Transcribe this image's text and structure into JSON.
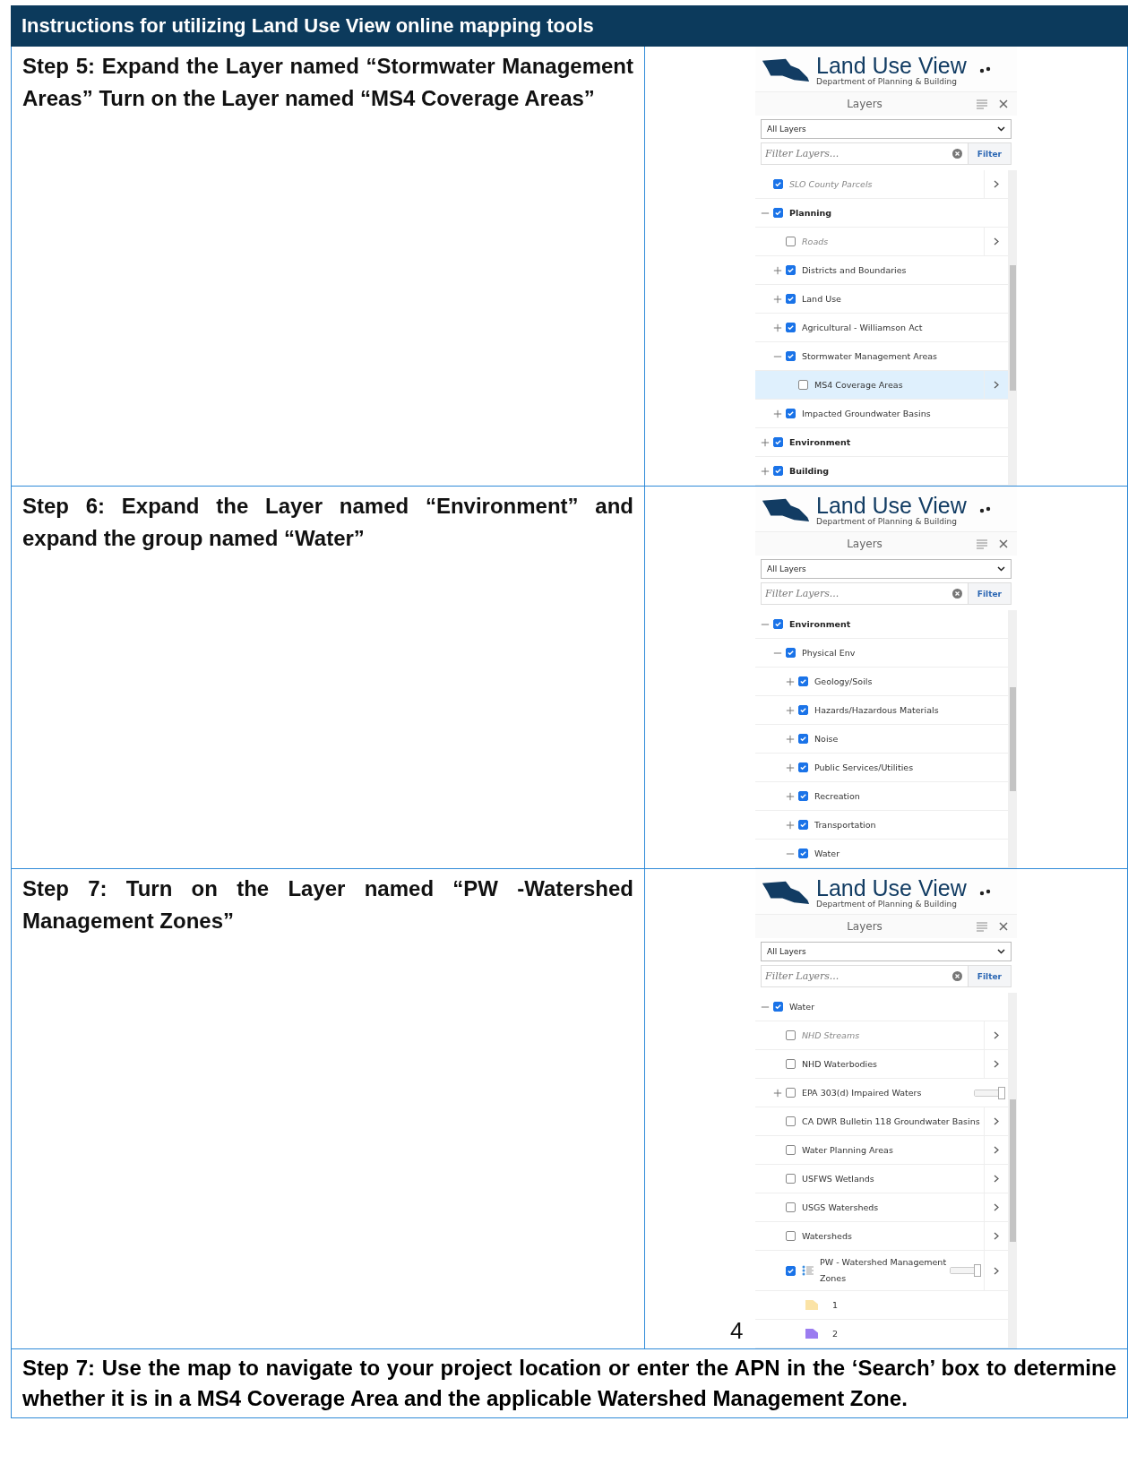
{
  "header": {
    "title": "Instructions for utilizing Land Use View online mapping tools"
  },
  "steps": [
    {
      "text": "Step 5: Expand the Layer named “Stormwater Management Areas” Turn on the Layer named “MS4 Coverage Areas”",
      "panel": {
        "app_title": "Land Use View",
        "app_subtitle": "Department of Planning & Building",
        "panel_title": "Layers",
        "dropdown": "All Layers",
        "filter": {
          "placeholder": "Filter Layers...",
          "button": "Filter"
        },
        "tree": [
          {
            "label": "SLO County Parcels",
            "kind": "dimmed",
            "checked": true,
            "selected": false,
            "arrow": true
          },
          {
            "label": "Planning",
            "kind": "group",
            "checked": true,
            "selected": false,
            "expanded": true,
            "children": [
              {
                "label": "Roads",
                "kind": "dimmed",
                "checked": false,
                "selected": false,
                "arrow": true
              },
              {
                "label": "Districts and Boundaries",
                "kind": "layer",
                "checked": true,
                "selected": false,
                "expanded": false
              },
              {
                "label": "Land Use",
                "kind": "layer",
                "checked": true,
                "selected": false,
                "expanded": false
              },
              {
                "label": "Agricultural - Williamson Act",
                "kind": "layer",
                "checked": true,
                "selected": false,
                "expanded": false
              },
              {
                "label": "Stormwater Management Areas",
                "kind": "layer",
                "checked": true,
                "selected": false,
                "expanded": true,
                "children": [
                  {
                    "label": "MS4 Coverage Areas",
                    "kind": "layer",
                    "checked": false,
                    "selected": true,
                    "arrow": true
                  }
                ]
              },
              {
                "label": "Impacted Groundwater Basins",
                "kind": "layer",
                "checked": true,
                "selected": false,
                "expanded": false
              }
            ]
          },
          {
            "label": "Environment",
            "kind": "group",
            "checked": true,
            "selected": false,
            "expanded": false
          },
          {
            "label": "Building",
            "kind": "group",
            "checked": true,
            "selected": false,
            "expanded": false
          }
        ]
      }
    },
    {
      "text": "Step 6: Expand the Layer named “Environment” and expand the group named “Water”",
      "panel": {
        "app_title": "Land Use View",
        "app_subtitle": "Department of Planning & Building",
        "panel_title": "Layers",
        "dropdown": "All Layers",
        "filter": {
          "placeholder": "Filter Layers...",
          "button": "Filter"
        },
        "tree": [
          {
            "label": "Environment",
            "kind": "group",
            "checked": true,
            "selected": false,
            "expanded": true,
            "children": [
              {
                "label": "Physical Env",
                "kind": "layer",
                "checked": true,
                "selected": false,
                "expanded": true,
                "children": [
                  {
                    "label": "Geology/Soils",
                    "kind": "layer",
                    "checked": true,
                    "selected": false,
                    "expanded": false
                  },
                  {
                    "label": "Hazards/Hazardous Materials",
                    "kind": "layer",
                    "checked": true,
                    "selected": false,
                    "expanded": false
                  },
                  {
                    "label": "Noise",
                    "kind": "layer",
                    "checked": true,
                    "selected": false,
                    "expanded": false
                  },
                  {
                    "label": "Public Services/Utilities",
                    "kind": "layer",
                    "checked": true,
                    "selected": false,
                    "expanded": false
                  },
                  {
                    "label": "Recreation",
                    "kind": "layer",
                    "checked": true,
                    "selected": false,
                    "expanded": false
                  },
                  {
                    "label": "Transportation",
                    "kind": "layer",
                    "checked": true,
                    "selected": false,
                    "expanded": false
                  },
                  {
                    "label": "Water",
                    "kind": "layer",
                    "checked": true,
                    "selected": false,
                    "expanded": true
                  }
                ]
              }
            ]
          }
        ]
      }
    },
    {
      "text": "Step 7: Turn on the Layer named “PW   -Watershed Management Zones”",
      "panel": {
        "app_title": "Land Use View",
        "app_subtitle": "Department of Planning & Building",
        "panel_title": "Layers",
        "dropdown": "All Layers",
        "filter": {
          "placeholder": "Filter Layers...",
          "button": "Filter"
        },
        "tree": [
          {
            "label": "Water",
            "kind": "layer",
            "checked": true,
            "selected": false,
            "expanded": true,
            "children": [
              {
                "label": "NHD Streams",
                "kind": "dimmed",
                "checked": false,
                "selected": false,
                "arrow": true
              },
              {
                "label": "NHD Waterbodies",
                "kind": "layer",
                "checked": false,
                "selected": false,
                "arrow": true
              },
              {
                "label": "EPA 303(d) Impaired Waters",
                "kind": "layer",
                "checked": false,
                "selected": false,
                "expanded": false,
                "level": 1
              },
              {
                "label": "CA DWR Bulletin 118 Groundwater Basins",
                "kind": "layer",
                "checked": false,
                "selected": false,
                "arrow": true
              },
              {
                "label": "Water Planning Areas",
                "kind": "layer",
                "checked": false,
                "selected": false,
                "arrow": true
              },
              {
                "label": "USFWS Wetlands",
                "kind": "layer",
                "checked": false,
                "selected": false,
                "arrow": true
              },
              {
                "label": "USGS Watersheds",
                "kind": "layer",
                "checked": false,
                "selected": false,
                "arrow": true
              },
              {
                "label": "Watersheds",
                "kind": "layer",
                "checked": false,
                "selected": false,
                "arrow": true
              },
              {
                "label": "PW - Watershed Management Zones",
                "kind": "legend_layer",
                "checked": true,
                "selected": false,
                "arrow": true,
                "level": 1,
                "children": [
                  {
                    "label": "1",
                    "kind": "legend",
                    "color": "#fbe3a6"
                  },
                  {
                    "label": "2",
                    "kind": "legend",
                    "color": "#9b7cf0"
                  }
                ]
              }
            ]
          }
        ]
      },
      "page_number": "4"
    }
  ],
  "final_step": "Step 7: Use the map to navigate to your project location or enter the APN in the ‘Search’ box to determine whether it is in a MS4 Coverage Area and the applicable Watershed Management Zone."
}
